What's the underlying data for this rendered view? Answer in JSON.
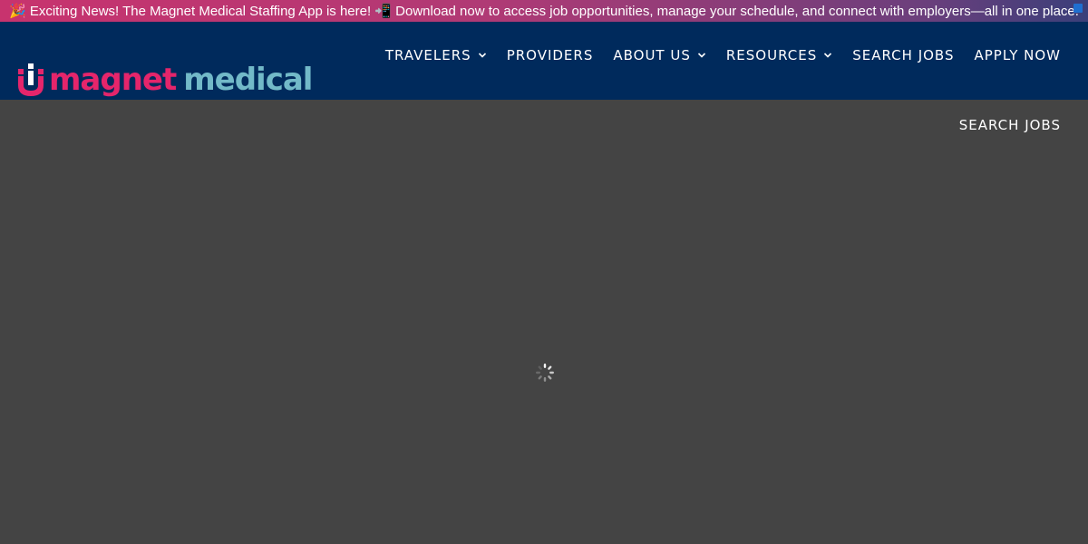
{
  "announcement": {
    "text": "🎉 Exciting News! The Magnet Medical Staffing App is here! 📲 Download now to access job opportunities, manage your schedule, and connect with employers—all in one place."
  },
  "logo": {
    "word1": "magnet",
    "word2": "medical",
    "colors": {
      "primary": "#e5256b",
      "secondary": "#72b9c8"
    }
  },
  "nav": {
    "items": [
      {
        "label": "TRAVELERS",
        "has_dropdown": true
      },
      {
        "label": "PROVIDERS",
        "has_dropdown": false
      },
      {
        "label": "ABOUT US",
        "has_dropdown": true
      },
      {
        "label": "RESOURCES",
        "has_dropdown": true
      },
      {
        "label": "SEARCH JOBS",
        "has_dropdown": false
      },
      {
        "label": "APPLY NOW",
        "has_dropdown": false
      }
    ],
    "icon": "chevron-down-icon"
  },
  "secondary": {
    "search_jobs_label": "SEARCH JOBS"
  },
  "theme": {
    "header_bg": "#002a5c",
    "page_bg": "#444444"
  },
  "loader": {
    "icon": "loading-spinner-icon"
  }
}
